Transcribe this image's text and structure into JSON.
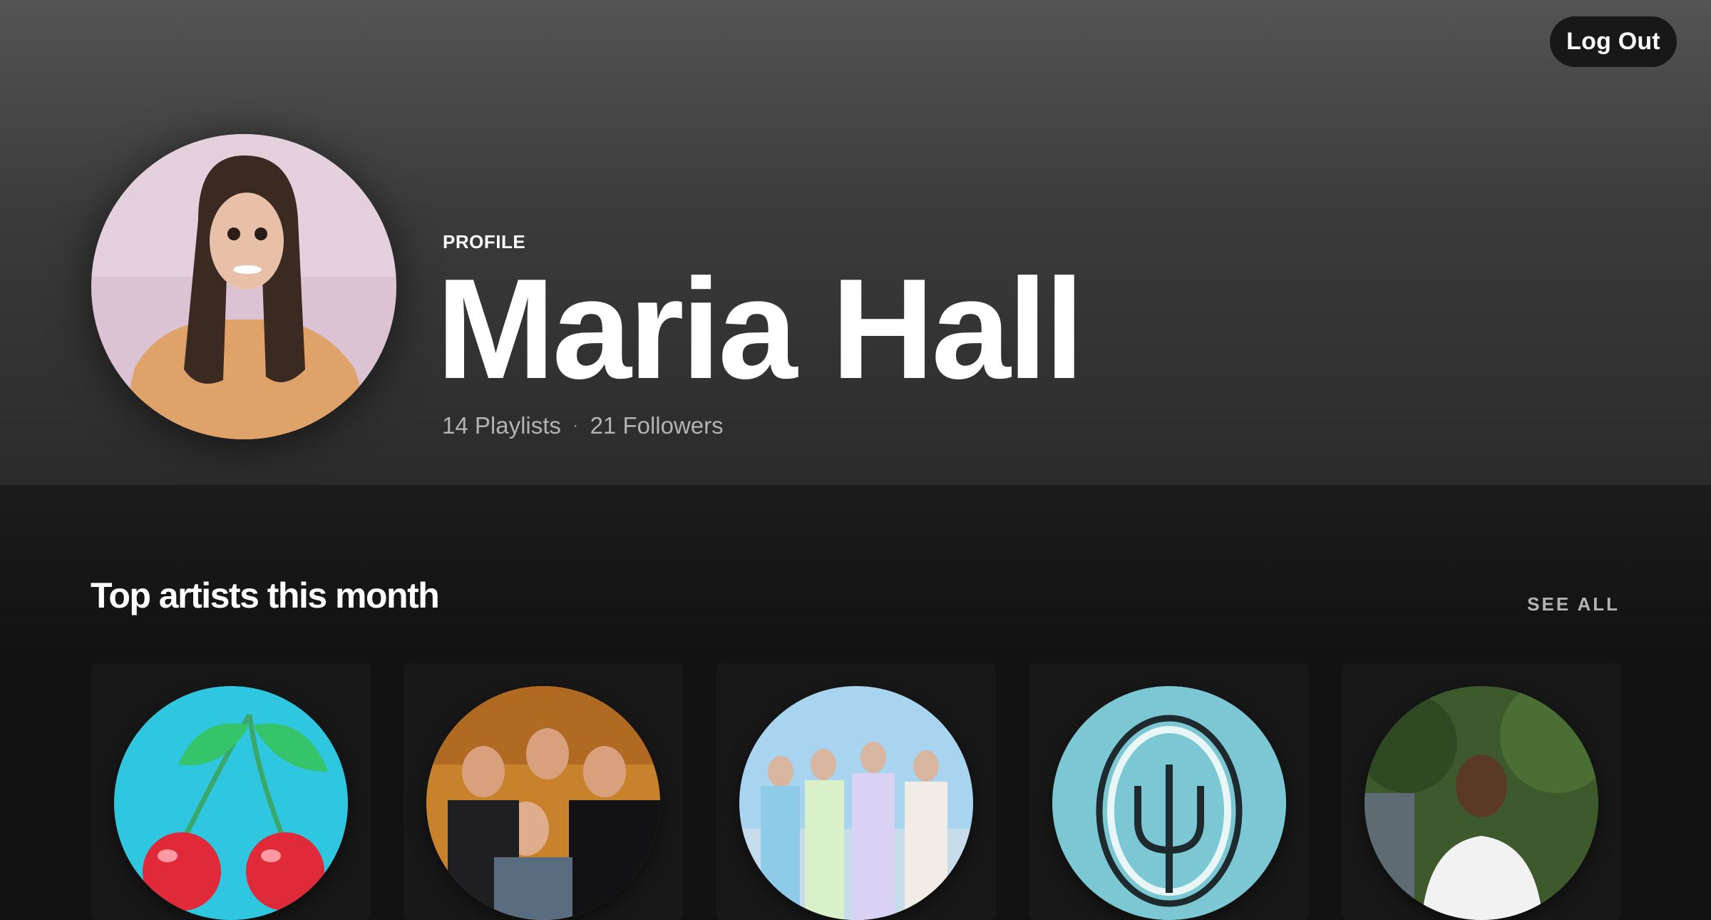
{
  "header": {
    "logout_label": "Log Out"
  },
  "profile": {
    "label": "PROFILE",
    "name": "Maria Hall",
    "playlists": "14 Playlists",
    "separator": "·",
    "followers": "21 Followers"
  },
  "top_artists": {
    "title": "Top artists this month",
    "see_all_label": "SEE ALL",
    "items": [
      {
        "art": "cherries-artwork"
      },
      {
        "art": "band-group-photo"
      },
      {
        "art": "band-lineup-photo"
      },
      {
        "art": "trident-logo"
      },
      {
        "art": "artist-portrait"
      }
    ]
  },
  "colors": {
    "hero_top": "#545454",
    "hero_bottom": "#2b2b2b",
    "background": "#121212",
    "card": "#181818",
    "muted_text": "#b3b3b3"
  }
}
